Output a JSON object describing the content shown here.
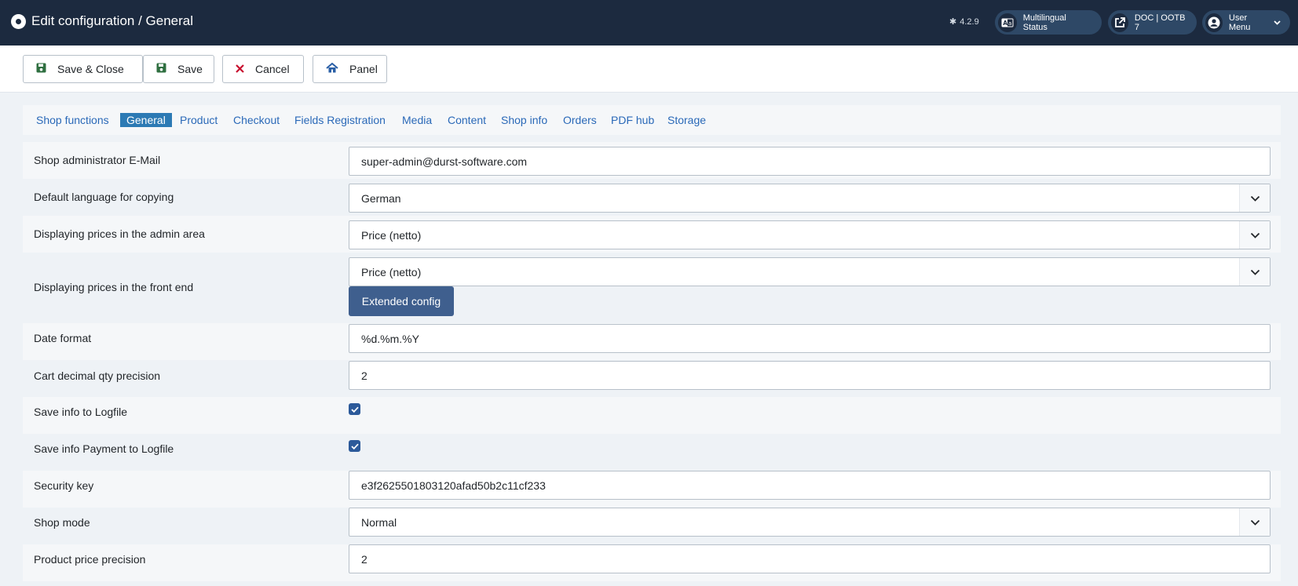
{
  "header": {
    "title": "Edit configuration / General",
    "version": "4.2.9",
    "multilingual_label": "Multilingual Status",
    "doc_label": "DOC | OOTB 7",
    "user_menu_label": "User Menu"
  },
  "toolbar": {
    "save_close_label": "Save & Close",
    "save_label": "Save",
    "cancel_label": "Cancel",
    "panel_label": "Panel"
  },
  "tabs": [
    {
      "label": "Shop functions"
    },
    {
      "label": "General"
    },
    {
      "label": "Product"
    },
    {
      "label": "Checkout"
    },
    {
      "label": "Fields Registration"
    },
    {
      "label": "Media"
    },
    {
      "label": "Content"
    },
    {
      "label": "Shop info"
    },
    {
      "label": "Orders"
    },
    {
      "label": "PDF hub"
    },
    {
      "label": "Storage"
    }
  ],
  "active_tab": "General",
  "form": {
    "admin_email": {
      "label": "Shop administrator E-Mail",
      "value": "super-admin@durst-software.com"
    },
    "default_language": {
      "label": "Default language for copying",
      "value": "German"
    },
    "prices_admin": {
      "label": "Displaying prices in the admin area",
      "value": "Price (netto)"
    },
    "prices_frontend": {
      "label": "Displaying prices in the front end",
      "value": "Price (netto)",
      "button_label": "Extended config"
    },
    "date_format": {
      "label": "Date format",
      "value": "%d.%m.%Y"
    },
    "cart_precision": {
      "label": "Cart decimal qty precision",
      "value": "2"
    },
    "log_info": {
      "label": "Save info to Logfile",
      "checked": true
    },
    "log_payment": {
      "label": "Save info Payment to Logfile",
      "checked": true
    },
    "security_key": {
      "label": "Security key",
      "value": "e3f2625501803120afad50b2c11cf233"
    },
    "shop_mode": {
      "label": "Shop mode",
      "value": "Normal"
    },
    "price_precision": {
      "label": "Product price precision",
      "value": "2"
    }
  },
  "colors": {
    "header_bg": "#1c2a3f",
    "accent": "#2c7ab4",
    "link": "#2a69b8",
    "button_primary": "#3f5f8e",
    "checkbox": "#2c5a9a",
    "cancel_icon": "#c8102e"
  },
  "icons": {
    "logo": "joomla-logo-icon",
    "version": "joomla-icon",
    "multilingual": "language-icon",
    "doc": "external-link-icon",
    "user": "user-circle-icon",
    "user_menu_chevron": "chevron-down-icon",
    "save_close": "floppy-disk-icon",
    "save": "floppy-disk-icon",
    "cancel": "close-icon",
    "panel": "home-icon",
    "select_arrow": "chevron-down-icon",
    "checkbox": "checkmark-icon"
  }
}
